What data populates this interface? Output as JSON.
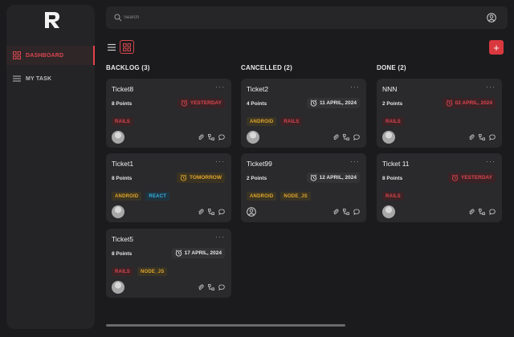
{
  "app": {
    "logo_letter": "R"
  },
  "sidebar": {
    "items": [
      {
        "label": "DASHBOARD",
        "icon": "dashboard-icon",
        "active": true
      },
      {
        "label": "MY TASK",
        "icon": "list-icon",
        "active": false
      }
    ]
  },
  "search": {
    "placeholder": "Search"
  },
  "colors": {
    "accent": "#d9383f",
    "background": "#1b1b1d",
    "panel": "#242427",
    "card": "#2a2a2d",
    "tag_red": "#d9474f",
    "tag_yellow": "#e2a72c",
    "tag_blue": "#3ab0e0"
  },
  "toolbar": {
    "add_label": "+"
  },
  "columns": [
    {
      "title": "BACKLOG (3)",
      "cards": [
        {
          "title": "Ticket8",
          "points": "8 Points",
          "due": "YESTERDAY",
          "due_color": "red",
          "tags": [
            "RAILS"
          ],
          "avatar": "photo"
        },
        {
          "title": "Ticket1",
          "points": "8 Points",
          "due": "TOMORROW",
          "due_color": "yellow",
          "tags": [
            "ANDROID",
            "REACT"
          ],
          "avatar": "photo"
        },
        {
          "title": "Ticket5",
          "points": "8 Points",
          "due": "17 APRIL, 2024",
          "due_color": "white",
          "tags": [
            "RAILS",
            "NODE_JS"
          ],
          "avatar": "photo"
        }
      ]
    },
    {
      "title": "CANCELLED (2)",
      "cards": [
        {
          "title": "Ticket2",
          "points": "4 Points",
          "due": "11 APRIL, 2024",
          "due_color": "white",
          "tags": [
            "ANDROID",
            "RAILS"
          ],
          "avatar": "photo"
        },
        {
          "title": "Ticket99",
          "points": "2 Points",
          "due": "12 APRIL, 2024",
          "due_color": "white",
          "tags": [
            "ANDROID",
            "NODE_JS"
          ],
          "avatar": "outline"
        }
      ]
    },
    {
      "title": "DONE (2)",
      "cards": [
        {
          "title": "NNN",
          "points": "2 Points",
          "due": "02 APRIL, 2024",
          "due_color": "red",
          "tags": [
            "RAILS"
          ],
          "avatar": "photo"
        },
        {
          "title": "Ticket 11",
          "points": "8 Points",
          "due": "YESTERDAY",
          "due_color": "red",
          "tags": [
            "RAILS"
          ],
          "avatar": "photo"
        }
      ]
    }
  ]
}
